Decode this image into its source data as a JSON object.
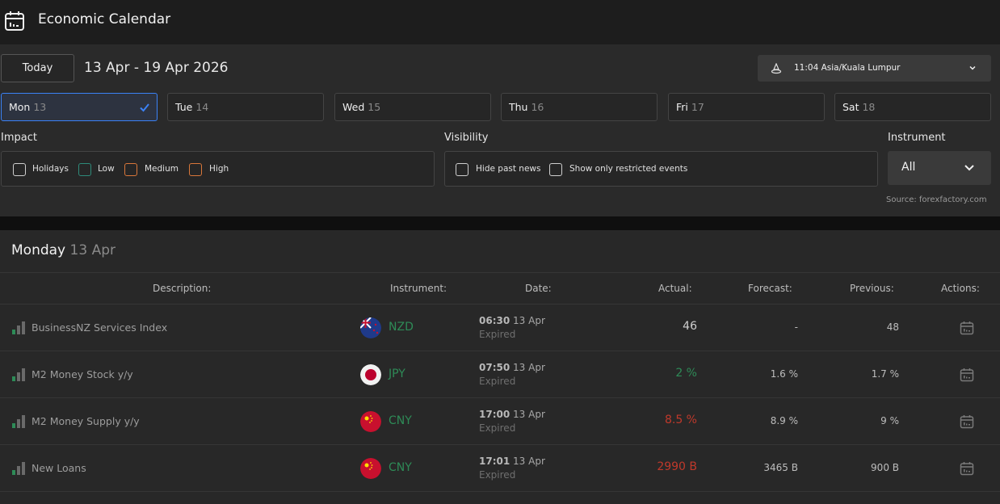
{
  "header": {
    "title": "Economic Calendar",
    "icon": "calendar-icon"
  },
  "toolbar": {
    "today_label": "Today",
    "date_range": "13 Apr - 19 Apr 2026",
    "timezone": "11:04 Asia/Kuala Lumpur"
  },
  "days": [
    {
      "name": "Mon",
      "num": "13"
    },
    {
      "name": "Tue",
      "num": "14"
    },
    {
      "name": "Wed",
      "num": "15"
    },
    {
      "name": "Thu",
      "num": "16"
    },
    {
      "name": "Fri",
      "num": "17"
    },
    {
      "name": "Sat",
      "num": "18"
    }
  ],
  "filters": {
    "impact_label": "Impact",
    "impact": [
      "Holidays",
      "Low",
      "Medium",
      "High"
    ],
    "visibility_label": "Visibility",
    "visibility": [
      "Hide past news",
      "Show only restricted events"
    ],
    "instrument_label": "Instrument",
    "instrument_value": "All",
    "source": "Source: forexfactory.com"
  },
  "colors": {
    "accent": "#3b82f6",
    "low": "#2e8b7a",
    "medium": "#d9773a",
    "high": "#d9773a",
    "positive": "#2e8b57",
    "negative": "#c0392b"
  },
  "section": {
    "day": "Monday",
    "date": "13 Apr"
  },
  "table": {
    "headers": {
      "description": "Description:",
      "instrument": "Instrument:",
      "date": "Date:",
      "actual": "Actual:",
      "forecast": "Forecast:",
      "previous": "Previous:",
      "actions": "Actions:"
    },
    "rows": [
      {
        "description": "BusinessNZ Services Index",
        "currency": "NZD",
        "time": "06:30",
        "date": "13 Apr",
        "status": "Expired",
        "actual": "46",
        "forecast": "-",
        "previous": "48"
      },
      {
        "description": "M2 Money Stock y/y",
        "currency": "JPY",
        "time": "07:50",
        "date": "13 Apr",
        "status": "Expired",
        "actual": "2 %",
        "forecast": "1.6 %",
        "previous": "1.7 %"
      },
      {
        "description": "M2 Money Supply y/y",
        "currency": "CNY",
        "time": "17:00",
        "date": "13 Apr",
        "status": "Expired",
        "actual": "8.5 %",
        "forecast": "8.9 %",
        "previous": "9 %"
      },
      {
        "description": "New Loans",
        "currency": "CNY",
        "time": "17:01",
        "date": "13 Apr",
        "status": "Expired",
        "actual": "2990 B",
        "forecast": "3465 B",
        "previous": "900 B"
      }
    ]
  }
}
